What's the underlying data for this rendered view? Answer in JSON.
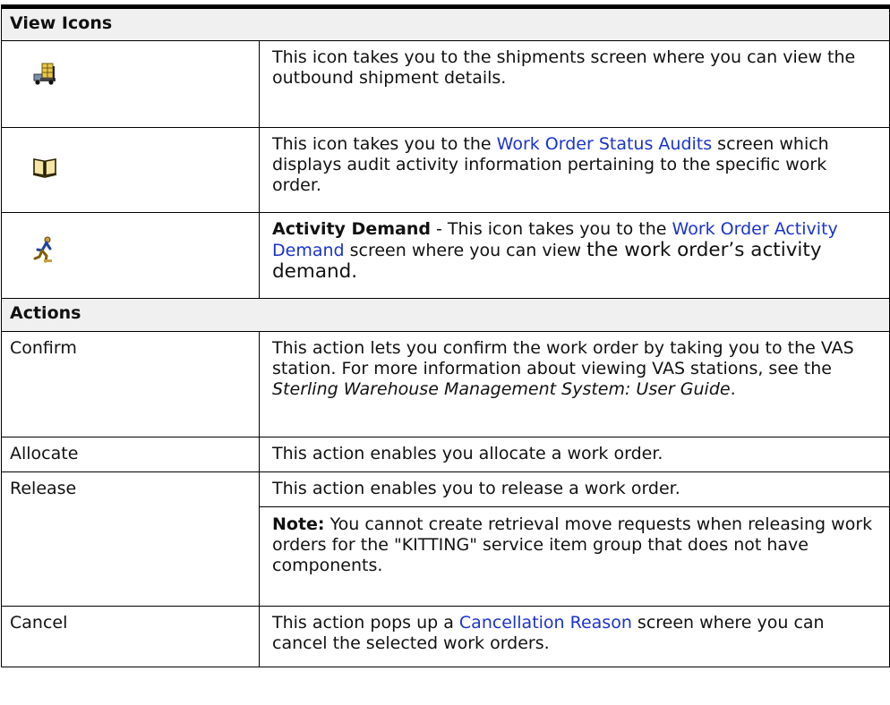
{
  "sections": {
    "view_icons": "View Icons",
    "actions": "Actions"
  },
  "view_icons": [
    {
      "icon": "shipment-truck-icon",
      "text": "This icon takes you to the shipments screen where you can view the outbound shipment details."
    },
    {
      "icon": "book-icon",
      "pre": "This icon takes you to the ",
      "link": "Work Order Status Audits",
      "post": " screen which displays audit activity information pertaining to the specific work order."
    },
    {
      "icon": "activity-demand-icon",
      "bold": "Activity Demand",
      "pre": " - This icon takes you to the ",
      "link": "Work Order Activity Demand",
      "mid": " screen where you can view ",
      "post": "the work order’s activity demand."
    }
  ],
  "actions": [
    {
      "name": "Confirm",
      "pre": "This action lets you confirm the work order by taking you to the VAS station. For more information about viewing VAS stations, see the ",
      "italic": "Sterling Warehouse Management System: User Guide",
      "post": "."
    },
    {
      "name": "Allocate",
      "text": "This action enables you allocate a work order."
    },
    {
      "name": "Release",
      "text": "This action enables you to release a work order.",
      "note_label": "Note:",
      "note": " You cannot create retrieval move requests when releasing work orders for the \"KITTING\" service item group that does not have components."
    },
    {
      "name": "Cancel",
      "pre": "This action pops up a ",
      "link": "Cancellation Reason",
      "post": " screen where you can cancel the selected work orders."
    }
  ]
}
